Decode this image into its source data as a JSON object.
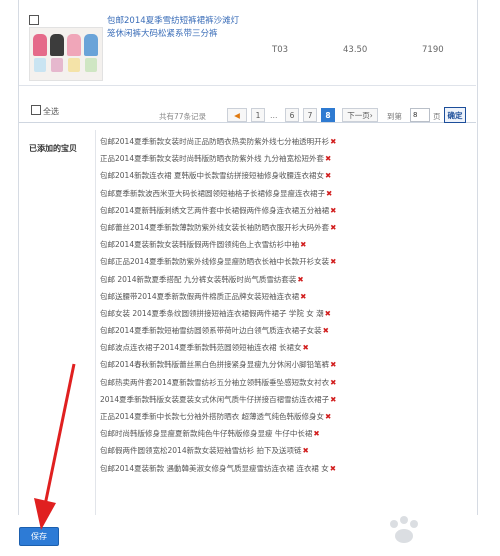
{
  "product": {
    "title": "包邮2014夏季雪纺短裤裙裤沙滩灯笼休闲裤大码松紧系带三分裤",
    "code": "T03",
    "price": "43.50",
    "stock": "7190"
  },
  "pager": {
    "select_all": "全选",
    "total": "共有77条记录",
    "prev": "◀",
    "pages": [
      "1",
      "6",
      "7",
      "8"
    ],
    "current_page": "8",
    "ellipsis": "…",
    "next": "下一页",
    "goto_label": "到第",
    "goto_value": "8",
    "goto_suffix": "页",
    "confirm": "确定"
  },
  "added": {
    "label": "已添加的宝贝",
    "remove_symbol": "✖",
    "items": [
      "包邮2014夏季新款女装时尚正品防晒衣热卖防紫外线七分袖透明开衫",
      "正品2014夏季新款女装时尚韩版防晒衣防紫外线 九分袖宽松短外套",
      "包邮2014新款连衣裙 夏韩版中长款雪纺拼接短袖修身收腰连衣裙女",
      "包邮夏季新款波西米亚大码长裙圆领短袖格子长裙修身显瘦连衣裙子",
      "包邮2014夏新韩版刺绣文艺两件套中长裙假两件修身连衣裙五分袖裙",
      "包邮蕾丝2014夏季新款薄款防紫外线女装长袖防晒衣服开衫大码外套",
      "包邮2014夏装新款女装韩版假两件圆领纯色上衣雪纺衫中袖",
      "包邮正品2014夏季新款防紫外线修身显瘦防晒衣长袖中长款开衫女装",
      "包邮 2014新款夏季搭配 九分裤女装韩版时尚气质雪纺套装",
      "包邮送腰带2014夏季新款假两件棉质正品牌女装短袖连衣裙",
      "包邮女装 2014夏季条纹圆领拼接短袖连衣裙假两件裙子 学院 女 潮",
      "包邮2014夏季新款短袖雪纺圆领系带荷叶边白领气质连衣裙子女装",
      "包邮波点连衣裙子2014夏季新款韩范圆领短袖连衣裙 长裙女",
      "包邮2014春秋新款韩版蕾丝黑白色拼接紧身显瘦九分休闲小脚铅笔裤",
      "包邮热卖两件套2014夏新款雪纺衫五分袖立领韩版垂坠感短款女衬衣",
      "2014夏季新款韩版女装夏装女式休闲气质牛仔拼接百褶雪纺连衣裙子",
      "正品2014夏季新中长款七分袖外搭防晒衣 超薄透气纯色韩版修身女",
      "包邮时尚韩版修身显瘦夏新款纯色牛仔韩版修身显瘦 牛仔中长裙",
      "包邮假两件圆领宽松2014新款女装短袖雪纺衫 拍下及送项链",
      "包邮2014夏装新款 遇動韓美淑女修身气质显瘦雪纺连衣裙 连衣裙 女"
    ]
  },
  "save_label": "保存",
  "colors": {
    "accent": "#2d7bd6",
    "remove": "#d21e1e",
    "link": "#3a6db8",
    "arrow": "#e02020"
  }
}
